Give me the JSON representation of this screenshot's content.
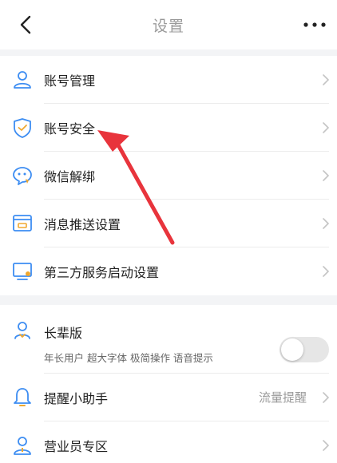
{
  "header": {
    "title": "设置",
    "back_icon": "chevron-left-icon",
    "more_icon": "more-dots-icon"
  },
  "menu": [
    {
      "label": "账号管理",
      "icon": "user-icon"
    },
    {
      "label": "账号安全",
      "icon": "shield-check-icon"
    },
    {
      "label": "微信解绑",
      "icon": "wechat-icon"
    },
    {
      "label": "消息推送设置",
      "icon": "message-icon"
    },
    {
      "label": "第三方服务启动设置",
      "icon": "monitor-icon"
    }
  ],
  "elder": {
    "label": "长辈版",
    "icon": "elder-icon",
    "description": "年长用户 超大字体 极简操作 语音提示",
    "enabled": false
  },
  "reminder": {
    "label": "提醒小助手",
    "icon": "bell-icon",
    "value": "流量提醒"
  },
  "staff": {
    "label": "营业员专区",
    "icon": "person-icon"
  },
  "colors": {
    "accent": "#3d8df2",
    "arrow": "#e8343c",
    "background": "#f3f4f6"
  }
}
